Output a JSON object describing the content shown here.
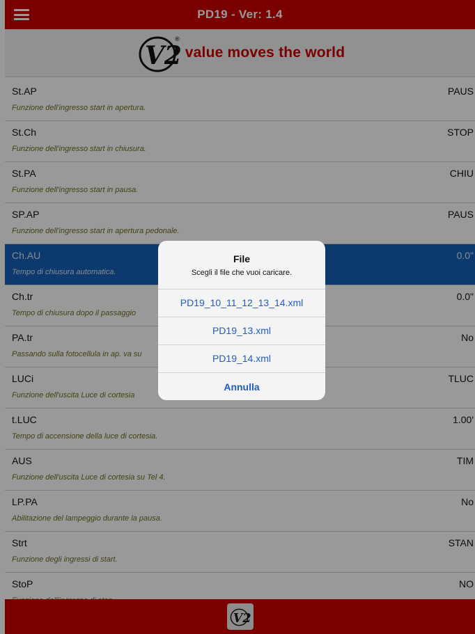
{
  "app": {
    "title": "PD19 - Ver: 1.4",
    "accent": "#cc0000"
  },
  "branding": {
    "slogan": "value moves the world",
    "logo_text": "V2",
    "logo_mark": "®"
  },
  "parameters": [
    {
      "name": "St.AP",
      "desc": "Funzione dell'ingresso start in apertura.",
      "value": "PAUS"
    },
    {
      "name": "St.Ch",
      "desc": "Funzione dell'ingresso start in chiusura.",
      "value": "STOP"
    },
    {
      "name": "St.PA",
      "desc": "Funzione dell'ingresso start in pausa.",
      "value": "CHIU"
    },
    {
      "name": "SP.AP",
      "desc": "Funzione dell'ingresso start in apertura pedonale.",
      "value": "PAUS"
    },
    {
      "name": "Ch.AU",
      "desc": "Tempo di chiusura automatica.",
      "value": "0.0\""
    },
    {
      "name": "Ch.tr",
      "desc": "Tempo di chiusura dopo il passaggio",
      "value": "0.0\""
    },
    {
      "name": "PA.tr",
      "desc": "Passando sulla fotocellula in ap. va su",
      "value": "No"
    },
    {
      "name": "LUCi",
      "desc": "Funzione dell'uscita Luce di cortesia",
      "value": "TLUC"
    },
    {
      "name": "t.LUC",
      "desc": "Tempo di accensione della luce di cortesia.",
      "value": "1.00'"
    },
    {
      "name": "AUS",
      "desc": "Funzione dell'uscita Luce di cortesia su Tel 4.",
      "value": "TIM"
    },
    {
      "name": "LP.PA",
      "desc": "Abilitazione del lampeggio durante la pausa.",
      "value": "No"
    },
    {
      "name": "Strt",
      "desc": "Funzione degli ingressi di start.",
      "value": "STAN"
    },
    {
      "name": "StoP",
      "desc": "Funzione dell'ingresso di stop.",
      "value": "NO"
    }
  ],
  "selected_index": 4,
  "dialog": {
    "title": "File",
    "message": "Scegli il file che vuoi caricare.",
    "options": [
      "PD19_10_11_12_13_14.xml",
      "PD19_13.xml",
      "PD19_14.xml"
    ],
    "cancel": "Annulla"
  }
}
